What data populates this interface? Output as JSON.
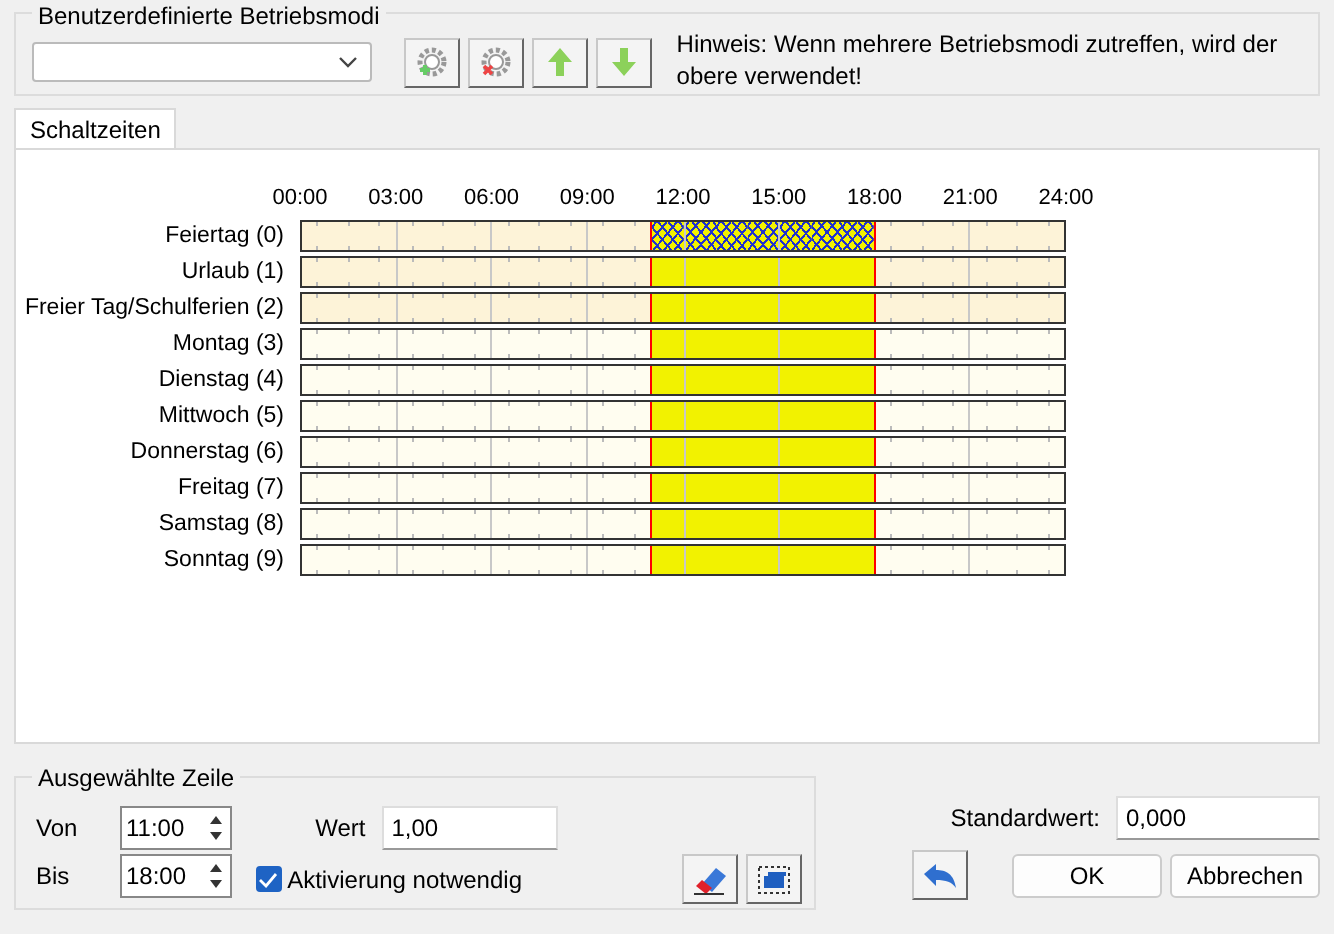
{
  "mode_group": {
    "title": "Benutzerdefinierte Betriebsmodi",
    "hint": "Hinweis: Wenn mehrere Betriebsmodi zutreffen, wird der obere verwendet!"
  },
  "tabs": [
    {
      "label": "Schaltzeiten",
      "selected": true
    }
  ],
  "schedule": {
    "hours": [
      "00:00",
      "03:00",
      "06:00",
      "09:00",
      "12:00",
      "15:00",
      "18:00",
      "21:00",
      "24:00"
    ],
    "rows": [
      {
        "label": "Feiertag (0)",
        "kind": "special",
        "selected": true,
        "hours_on": [
          false,
          false,
          false,
          false,
          false,
          false,
          false,
          false,
          false,
          false,
          false,
          true,
          true,
          true,
          true,
          true,
          true,
          true,
          false,
          false,
          false,
          false,
          false,
          false
        ]
      },
      {
        "label": "Urlaub (1)",
        "kind": "special",
        "selected": false,
        "hours_on": [
          false,
          false,
          false,
          false,
          false,
          false,
          false,
          false,
          false,
          false,
          false,
          true,
          true,
          true,
          true,
          true,
          true,
          true,
          false,
          false,
          false,
          false,
          false,
          false
        ]
      },
      {
        "label": "Freier Tag/Schulferien (2)",
        "kind": "special",
        "selected": false,
        "hours_on": [
          false,
          false,
          false,
          false,
          false,
          false,
          false,
          false,
          false,
          false,
          false,
          true,
          true,
          true,
          true,
          true,
          true,
          true,
          false,
          false,
          false,
          false,
          false,
          false
        ]
      },
      {
        "label": "Montag (3)",
        "kind": "weekday",
        "selected": false,
        "hours_on": [
          false,
          false,
          false,
          false,
          false,
          false,
          false,
          false,
          false,
          false,
          false,
          true,
          true,
          true,
          true,
          true,
          true,
          true,
          false,
          false,
          false,
          false,
          false,
          false
        ]
      },
      {
        "label": "Dienstag (4)",
        "kind": "weekday",
        "selected": false,
        "hours_on": [
          false,
          false,
          false,
          false,
          false,
          false,
          false,
          false,
          false,
          false,
          false,
          true,
          true,
          true,
          true,
          true,
          true,
          true,
          false,
          false,
          false,
          false,
          false,
          false
        ]
      },
      {
        "label": "Mittwoch (5)",
        "kind": "weekday",
        "selected": false,
        "hours_on": [
          false,
          false,
          false,
          false,
          false,
          false,
          false,
          false,
          false,
          false,
          false,
          true,
          true,
          true,
          true,
          true,
          true,
          true,
          false,
          false,
          false,
          false,
          false,
          false
        ]
      },
      {
        "label": "Donnerstag (6)",
        "kind": "weekday",
        "selected": false,
        "hours_on": [
          false,
          false,
          false,
          false,
          false,
          false,
          false,
          false,
          false,
          false,
          false,
          true,
          true,
          true,
          true,
          true,
          true,
          true,
          false,
          false,
          false,
          false,
          false,
          false
        ]
      },
      {
        "label": "Freitag (7)",
        "kind": "weekday",
        "selected": false,
        "hours_on": [
          false,
          false,
          false,
          false,
          false,
          false,
          false,
          false,
          false,
          false,
          false,
          true,
          true,
          true,
          true,
          true,
          true,
          true,
          false,
          false,
          false,
          false,
          false,
          false
        ]
      },
      {
        "label": "Samstag (8)",
        "kind": "weekday",
        "selected": false,
        "hours_on": [
          false,
          false,
          false,
          false,
          false,
          false,
          false,
          false,
          false,
          false,
          false,
          true,
          true,
          true,
          true,
          true,
          true,
          true,
          false,
          false,
          false,
          false,
          false,
          false
        ]
      },
      {
        "label": "Sonntag (9)",
        "kind": "weekday",
        "selected": false,
        "hours_on": [
          false,
          false,
          false,
          false,
          false,
          false,
          false,
          false,
          false,
          false,
          false,
          true,
          true,
          true,
          true,
          true,
          true,
          true,
          false,
          false,
          false,
          false,
          false,
          false
        ]
      }
    ]
  },
  "selected_row": {
    "title": "Ausgewählte Zeile",
    "from_label": "Von",
    "from": "11:00",
    "to_label": "Bis",
    "to": "18:00",
    "value_label": "Wert",
    "value": "1,00",
    "activation": {
      "label": "Aktivierung notwendig",
      "checked": true
    }
  },
  "default_value": {
    "label": "Standardwert:",
    "value": "0,000"
  },
  "buttons": [
    "OK",
    "Abbrechen"
  ]
}
